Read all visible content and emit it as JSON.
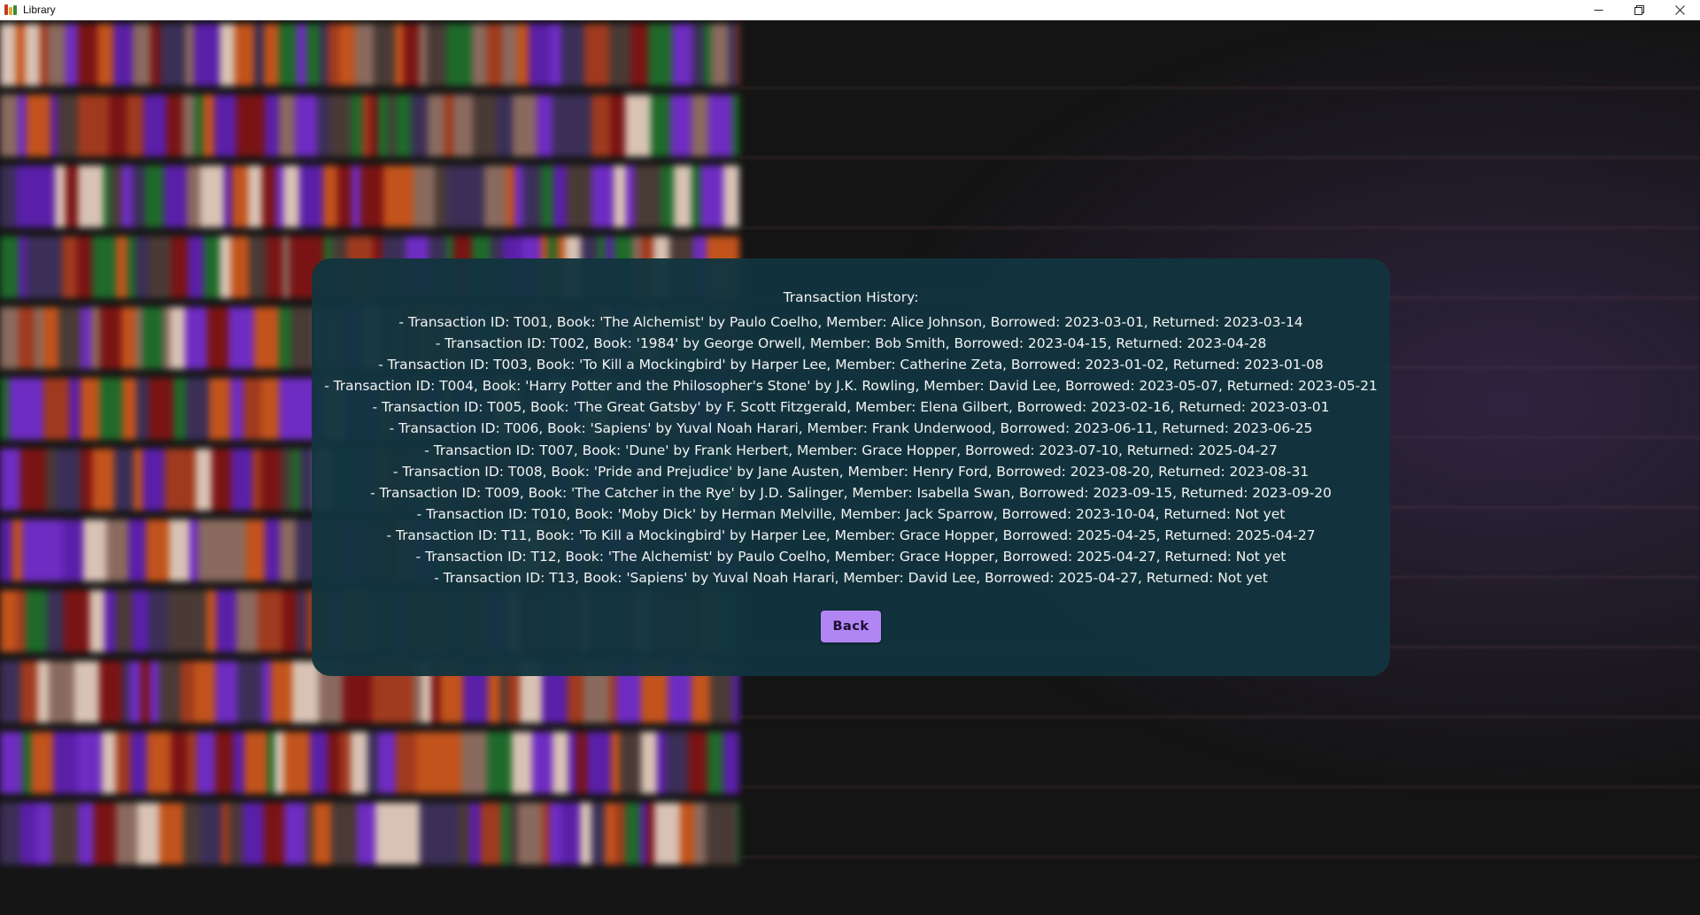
{
  "window": {
    "title": "Library",
    "icon": "library-books-icon",
    "controls": [
      "minimize-icon",
      "restore-icon",
      "close-icon"
    ]
  },
  "panel": {
    "title": "Transaction History:",
    "transactions": [
      "- Transaction ID: T001, Book: 'The Alchemist' by Paulo Coelho, Member: Alice Johnson, Borrowed: 2023-03-01, Returned: 2023-03-14",
      "- Transaction ID: T002, Book: '1984' by George Orwell, Member: Bob Smith, Borrowed: 2023-04-15, Returned: 2023-04-28",
      "- Transaction ID: T003, Book: 'To Kill a Mockingbird' by Harper Lee, Member: Catherine Zeta, Borrowed: 2023-01-02, Returned: 2023-01-08",
      "- Transaction ID: T004, Book: 'Harry Potter and the Philosopher's Stone' by J.K. Rowling, Member: David Lee, Borrowed: 2023-05-07, Returned: 2023-05-21",
      "- Transaction ID: T005, Book: 'The Great Gatsby' by F. Scott Fitzgerald, Member: Elena Gilbert, Borrowed: 2023-02-16, Returned: 2023-03-01",
      "- Transaction ID: T006, Book: 'Sapiens' by Yuval Noah Harari, Member: Frank Underwood, Borrowed: 2023-06-11, Returned: 2023-06-25",
      "- Transaction ID: T007, Book: 'Dune' by Frank Herbert, Member: Grace Hopper, Borrowed: 2023-07-10, Returned: 2025-04-27",
      "- Transaction ID: T008, Book: 'Pride and Prejudice' by Jane Austen, Member: Henry Ford, Borrowed: 2023-08-20, Returned: 2023-08-31",
      "- Transaction ID: T009, Book: 'The Catcher in the Rye' by J.D. Salinger, Member: Isabella Swan, Borrowed: 2023-09-15, Returned: 2023-09-20",
      "- Transaction ID: T010, Book: 'Moby Dick' by Herman Melville, Member: Jack Sparrow, Borrowed: 2023-10-04, Returned: Not yet",
      "- Transaction ID: T11, Book: 'To Kill a Mockingbird' by Harper Lee, Member: Grace Hopper, Borrowed: 2025-04-25, Returned: 2025-04-27",
      "- Transaction ID: T12, Book: 'The Alchemist' by Paulo Coelho, Member: Grace Hopper, Borrowed: 2025-04-27, Returned: Not yet",
      "- Transaction ID: T13, Book: 'Sapiens' by Yuval Noah Harari, Member: David Lee, Borrowed: 2025-04-27, Returned: Not yet"
    ],
    "back_label": "Back"
  },
  "colors": {
    "panel_bg": "#12343e",
    "button_bg": "#b285f5",
    "book_palette": [
      "#7a1414",
      "#5a1fa8",
      "#c2531c",
      "#1f6a2a",
      "#8a6a5e",
      "#d8c2b4",
      "#4a3a36",
      "#6e2cc2",
      "#a03a1e",
      "#3b2f57"
    ]
  }
}
